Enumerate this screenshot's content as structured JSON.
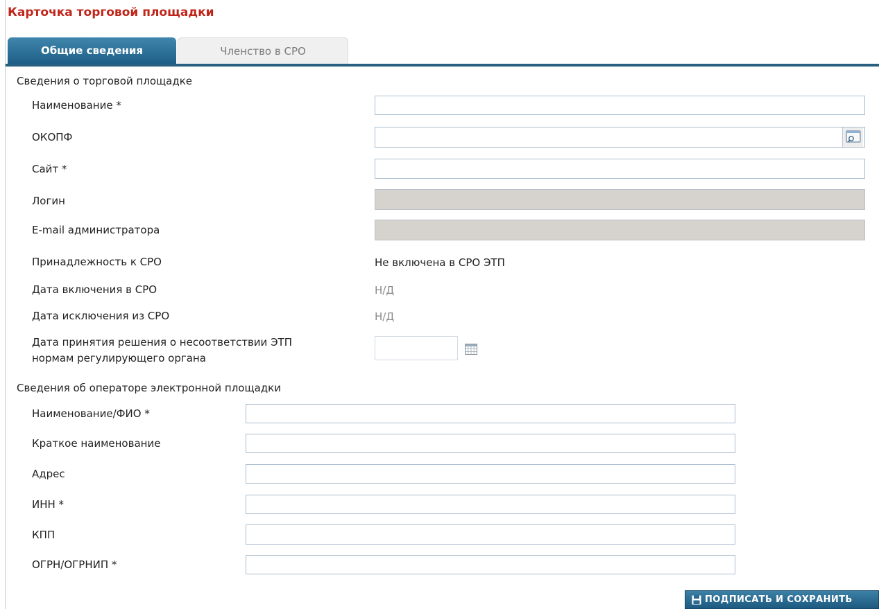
{
  "page": {
    "title": "Карточка торговой площадки"
  },
  "tabs": [
    {
      "label": "Общие сведения",
      "active": true
    },
    {
      "label": "Членство в СРО",
      "active": false
    }
  ],
  "platform_section": {
    "title": "Сведения о торговой площадке",
    "name_label": "Наименование *",
    "name_value": "",
    "okopf_label": "ОКОПФ",
    "okopf_value": "",
    "site_label": "Сайт *",
    "site_value": "",
    "login_label": "Логин",
    "login_value": "",
    "admin_email_label": "E-mail администратора",
    "admin_email_value": "",
    "sro_membership_label": "Принадлежность к СРО",
    "sro_membership_value": "Не включена в СРО ЭТП",
    "sro_inclusion_date_label": "Дата включения в СРО",
    "sro_inclusion_date_value": "Н/Д",
    "sro_exclusion_date_label": "Дата исключения из СРО",
    "sro_exclusion_date_value": "Н/Д",
    "decision_date_label_line1": "Дата принятия решения о несоответствии ЭТП",
    "decision_date_label_line2": "нормам регулирующего органа",
    "decision_date_value": ""
  },
  "operator_section": {
    "title": "Сведения об операторе электронной площадки",
    "name_label": "Наименование/ФИО *",
    "name_value": "",
    "short_name_label": "Краткое наименование",
    "short_name_value": "",
    "address_label": "Адрес",
    "address_value": "",
    "inn_label": "ИНН *",
    "inn_value": "",
    "kpp_label": "КПП",
    "kpp_value": "",
    "ogrn_label": "ОГРН/ОГРНИП *",
    "ogrn_value": ""
  },
  "actions": {
    "sign_and_save_label": "ПОДПИСАТЬ И СОХРАНИТЬ"
  },
  "icons": {
    "lookup": "magnifier-window-icon",
    "calendar": "calendar-icon",
    "save": "floppy-disk-icon"
  },
  "colors": {
    "title_red": "#c0251a",
    "accent_blue": "#265f80",
    "disabled_field": "#d6d2cd",
    "muted_text": "#8a8a8a"
  }
}
